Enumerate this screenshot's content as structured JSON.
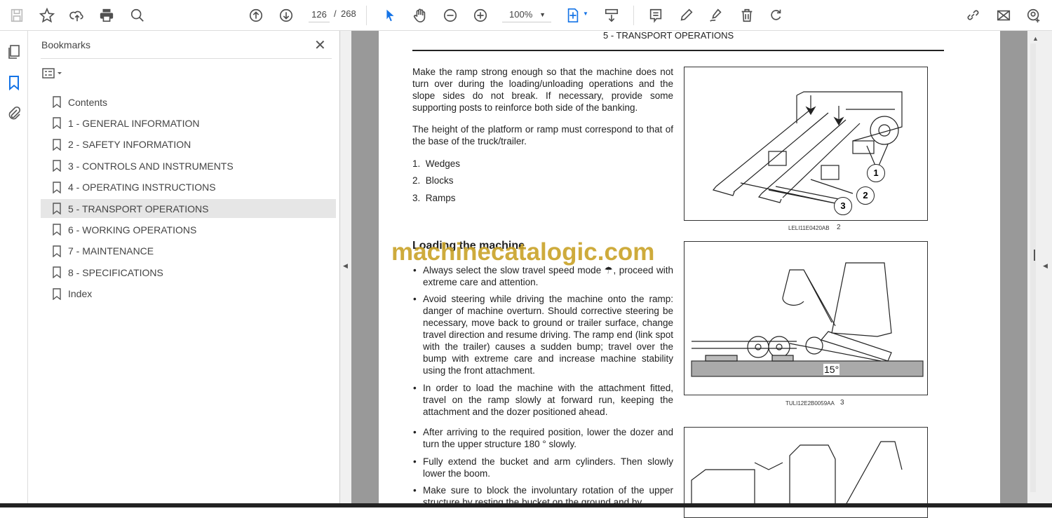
{
  "toolbar": {
    "page_current": "126",
    "page_sep": "/",
    "page_total": "268",
    "zoom": "100%"
  },
  "bookmarks": {
    "title": "Bookmarks",
    "items": [
      {
        "label": "Contents"
      },
      {
        "label": "1 - GENERAL INFORMATION"
      },
      {
        "label": "2 - SAFETY INFORMATION"
      },
      {
        "label": "3 - CONTROLS AND INSTRUMENTS"
      },
      {
        "label": "4 - OPERATING INSTRUCTIONS"
      },
      {
        "label": "5 - TRANSPORT OPERATIONS"
      },
      {
        "label": "6 - WORKING OPERATIONS"
      },
      {
        "label": "7 - MAINTENANCE"
      },
      {
        "label": "8 - SPECIFICATIONS"
      },
      {
        "label": "Index"
      }
    ],
    "selected_index": 5
  },
  "document": {
    "header": "5 - TRANSPORT OPERATIONS",
    "para1": "Make the ramp strong enough so that the machine does not turn over during the loading/unloading operations and the slope sides do not break. If necessary, provide some supporting posts to reinforce both side of the banking.",
    "para2": "The height of the platform or ramp must correspond to that of the base of the truck/trailer.",
    "list": [
      "1.  Wedges",
      "2.  Blocks",
      "3.  Ramps"
    ],
    "heading": "Loading the machine",
    "bullets": [
      "Always select the slow travel speed mode ☂, proceed with extreme care and attention.",
      "Avoid steering while driving the machine onto the ramp: danger of machine overturn. Should corrective steering be necessary, move back to ground or trailer surface, change travel direction and resume driving. The ramp end (link spot with the trailer) causes a sudden bump; travel over the bump with extreme care and increase machine stability using the front attachment.",
      "In order to load the machine with the attachment fitted, travel on the ramp slowly at forward run, keeping the attachment and the dozer positioned ahead.",
      "After arriving to the required position, lower the dozer and turn the upper structure 180 ° slowly.",
      "Fully extend the bucket and arm cylinders. Then slowly lower the boom.",
      "Make sure to block the involuntary rotation of the upper structure by resting the bucket on the ground and by"
    ],
    "fig1": {
      "code": "LELI11E0420AB",
      "num": "2",
      "callouts": [
        "1",
        "2",
        "3"
      ]
    },
    "fig2": {
      "code": "TULI12E2B0059AA",
      "num": "3",
      "angle": "15°"
    },
    "watermark": "machinecatalogic.com"
  }
}
